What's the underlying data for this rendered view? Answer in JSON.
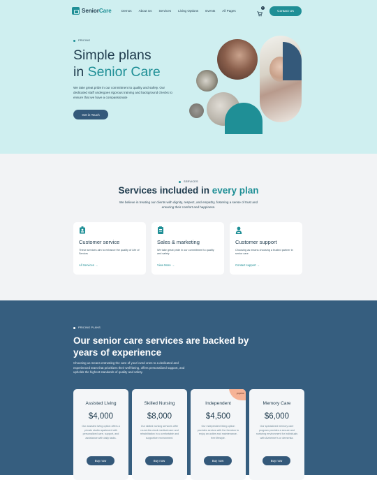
{
  "nav": {
    "logo_pre": "Senior",
    "logo_accent": "Care",
    "menu": [
      "Demos",
      "About Us",
      "Services",
      "Living Options",
      "Events",
      "All Pages"
    ],
    "cart_count": "0",
    "contact_label": "Contact Us"
  },
  "hero": {
    "eyebrow": "PRICING",
    "title_line1": "Simple plans",
    "title_pre": "in ",
    "title_accent": "Senior Care",
    "description": "We take great pride in our commitment to quality and safety. Our dedicated staff undergoes rigorous training and background checks to ensure that we have a compassionate",
    "cta": "Get in Touch"
  },
  "services": {
    "eyebrow": "SERVICES",
    "title_pre": "Services included in ",
    "title_accent": "every plan",
    "description": "We believe in treating our clients with dignity, respect, and empathy, fostering a sense of trust and ensuring their comfort and happiness.",
    "cards": [
      {
        "icon": "id-badge-icon",
        "title": "Customer service",
        "desc": "These services aim to enhance the quality of Life of Seniors",
        "link": "All Services"
      },
      {
        "icon": "clipboard-icon",
        "title": "Sales & marketing",
        "desc": "We take great pride in our commitment to quality and safety",
        "link": "View More"
      },
      {
        "icon": "support-agent-icon",
        "title": "Customer support",
        "desc": "Choosing as means choosing a trusted partner in senior care",
        "link": "Contact support"
      }
    ]
  },
  "pricing": {
    "eyebrow": "PRICING PLANS",
    "title": "Our senior care services are backed by years of experience",
    "description": "Choosing us means entrusting the care of your loved ones to a dedicated and experienced team that prioritizes their well-being, offers personalized support, and upholds the highest standards of quality and safety.",
    "badge": "popular",
    "plans": [
      {
        "name": "Assisted Living",
        "price": "$4,000",
        "desc": "Our assisted living option offers a private studio apartment with personalized care, support, and assistance with daily tasks.",
        "button": "Buy now"
      },
      {
        "name": "Skilled Nursing",
        "price": "$8,000",
        "desc": "Our skilled nursing services offer round-the-clock medical care and rehabilitation in a comfortable and supportive environment.",
        "button": "Buy now"
      },
      {
        "name": "Independent",
        "price": "$4,500",
        "desc": "Our independent living option provides seniors with the freedom to enjoy an active and maintenance-free lifestyle.",
        "button": "Buy now"
      },
      {
        "name": "Memory Care",
        "price": "$6,000",
        "desc": "Our specialized memory care program provides a secure and nurturing environment for individuals with Alzheimer's or dementia.",
        "button": "Buy now"
      }
    ]
  },
  "colors": {
    "teal": "#1f8f96",
    "navy": "#1f3b4d",
    "hero_bg": "#cfeff0",
    "pricing_bg": "#365e7f",
    "popular_badge": "#f6b396"
  }
}
